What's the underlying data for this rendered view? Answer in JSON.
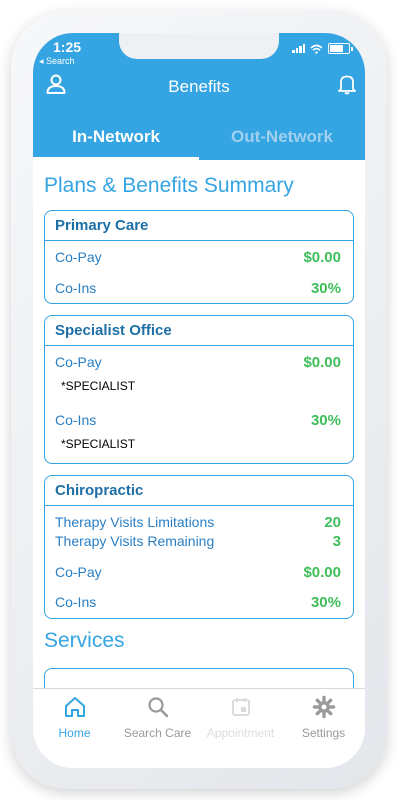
{
  "status_bar": {
    "time": "1:25",
    "back_label": "◂ Search"
  },
  "header": {
    "title": "Benefits"
  },
  "tabs": [
    {
      "label": "In-Network"
    },
    {
      "label": "Out-Network"
    }
  ],
  "summary": {
    "heading": "Plans & Benefits Summary",
    "primary_care": {
      "title": "Primary Care",
      "copay_label": "Co-Pay",
      "copay_value": "$0.00",
      "coins_label": "Co-Ins",
      "coins_value": "30%"
    },
    "specialist": {
      "title": "Specialist Office",
      "copay_label": "Co-Pay",
      "copay_value": "$0.00",
      "copay_note": "*SPECIALIST",
      "coins_label": "Co-Ins",
      "coins_value": "30%",
      "coins_note": "*SPECIALIST"
    },
    "chiropractic": {
      "title": "Chiropractic",
      "limits_label": "Therapy Visits Limitations",
      "limits_value": "20",
      "remaining_label": "Therapy Visits Remaining",
      "remaining_value": "3",
      "copay_label": "Co-Pay",
      "copay_value": "$0.00",
      "coins_label": "Co-Ins",
      "coins_value": "30%"
    }
  },
  "services": {
    "heading": "Services"
  },
  "tabbar": [
    {
      "label": "Home",
      "icon": "home-icon"
    },
    {
      "label": "Search Care",
      "icon": "search-icon"
    },
    {
      "label": "Appointment",
      "icon": "calendar-icon"
    },
    {
      "label": "Settings",
      "icon": "gear-icon"
    }
  ],
  "colors": {
    "brand": "#35a4e2",
    "value_green": "#3fbf5a",
    "title_dark_blue": "#1e6fa7"
  }
}
